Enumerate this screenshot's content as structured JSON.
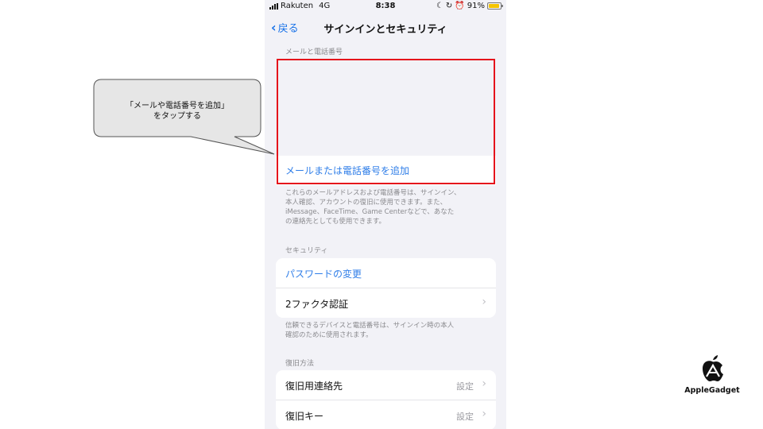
{
  "statusbar": {
    "carrier": "Rakuten",
    "network": "4G",
    "time": "8:38",
    "battery": "91%",
    "battery_level": 0.91,
    "icons": [
      "moon-icon",
      "lock-rotation-icon",
      "alarm-icon"
    ]
  },
  "navbar": {
    "back_label": "戻る",
    "title": "サインインとセキュリティ"
  },
  "email_section": {
    "header": "メールと電話番号",
    "add_label": "メールまたは電話番号を追加",
    "footnote_lines": [
      "これらのメールアドレスおよび電話番号は、サインイン、",
      "本人確認、アカウントの復旧に使用できます。また、",
      "iMessage、FaceTime、Game Centerなどで、あなた",
      "の連絡先としても使用できます。"
    ]
  },
  "security_section": {
    "header": "セキュリティ",
    "password_change": "パスワードの変更",
    "two_factor": "2ファクタ認証",
    "footnote_lines": [
      "信頼できるデバイスと電話番号は、サインイン時の本人",
      "確認のために使用されます。"
    ]
  },
  "recovery_section": {
    "header": "復旧方法",
    "items": [
      {
        "label": "復旧用連絡先",
        "value": "設定"
      },
      {
        "label": "復旧キー",
        "value": "設定"
      }
    ]
  },
  "callout": {
    "lines": [
      "「メールや電話番号を追加」",
      "をタップする"
    ]
  },
  "logo": {
    "text": "AppleGadget"
  },
  "colors": {
    "accent": "#2f7ee8",
    "highlight": "#e5131c"
  }
}
